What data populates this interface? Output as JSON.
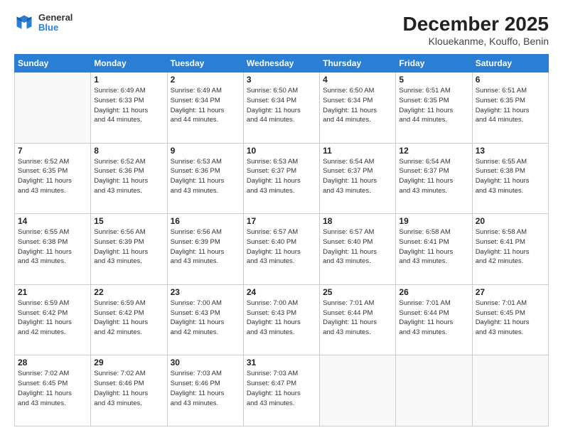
{
  "header": {
    "logo_general": "General",
    "logo_blue": "Blue",
    "month_title": "December 2025",
    "location": "Klouekanme, Kouffo, Benin"
  },
  "weekdays": [
    "Sunday",
    "Monday",
    "Tuesday",
    "Wednesday",
    "Thursday",
    "Friday",
    "Saturday"
  ],
  "weeks": [
    [
      {
        "day": "",
        "sunrise": "",
        "sunset": "",
        "daylight": ""
      },
      {
        "day": "1",
        "sunrise": "Sunrise: 6:49 AM",
        "sunset": "Sunset: 6:33 PM",
        "daylight": "Daylight: 11 hours and 44 minutes."
      },
      {
        "day": "2",
        "sunrise": "Sunrise: 6:49 AM",
        "sunset": "Sunset: 6:34 PM",
        "daylight": "Daylight: 11 hours and 44 minutes."
      },
      {
        "day": "3",
        "sunrise": "Sunrise: 6:50 AM",
        "sunset": "Sunset: 6:34 PM",
        "daylight": "Daylight: 11 hours and 44 minutes."
      },
      {
        "day": "4",
        "sunrise": "Sunrise: 6:50 AM",
        "sunset": "Sunset: 6:34 PM",
        "daylight": "Daylight: 11 hours and 44 minutes."
      },
      {
        "day": "5",
        "sunrise": "Sunrise: 6:51 AM",
        "sunset": "Sunset: 6:35 PM",
        "daylight": "Daylight: 11 hours and 44 minutes."
      },
      {
        "day": "6",
        "sunrise": "Sunrise: 6:51 AM",
        "sunset": "Sunset: 6:35 PM",
        "daylight": "Daylight: 11 hours and 44 minutes."
      }
    ],
    [
      {
        "day": "7",
        "sunrise": "Sunrise: 6:52 AM",
        "sunset": "Sunset: 6:35 PM",
        "daylight": "Daylight: 11 hours and 43 minutes."
      },
      {
        "day": "8",
        "sunrise": "Sunrise: 6:52 AM",
        "sunset": "Sunset: 6:36 PM",
        "daylight": "Daylight: 11 hours and 43 minutes."
      },
      {
        "day": "9",
        "sunrise": "Sunrise: 6:53 AM",
        "sunset": "Sunset: 6:36 PM",
        "daylight": "Daylight: 11 hours and 43 minutes."
      },
      {
        "day": "10",
        "sunrise": "Sunrise: 6:53 AM",
        "sunset": "Sunset: 6:37 PM",
        "daylight": "Daylight: 11 hours and 43 minutes."
      },
      {
        "day": "11",
        "sunrise": "Sunrise: 6:54 AM",
        "sunset": "Sunset: 6:37 PM",
        "daylight": "Daylight: 11 hours and 43 minutes."
      },
      {
        "day": "12",
        "sunrise": "Sunrise: 6:54 AM",
        "sunset": "Sunset: 6:37 PM",
        "daylight": "Daylight: 11 hours and 43 minutes."
      },
      {
        "day": "13",
        "sunrise": "Sunrise: 6:55 AM",
        "sunset": "Sunset: 6:38 PM",
        "daylight": "Daylight: 11 hours and 43 minutes."
      }
    ],
    [
      {
        "day": "14",
        "sunrise": "Sunrise: 6:55 AM",
        "sunset": "Sunset: 6:38 PM",
        "daylight": "Daylight: 11 hours and 43 minutes."
      },
      {
        "day": "15",
        "sunrise": "Sunrise: 6:56 AM",
        "sunset": "Sunset: 6:39 PM",
        "daylight": "Daylight: 11 hours and 43 minutes."
      },
      {
        "day": "16",
        "sunrise": "Sunrise: 6:56 AM",
        "sunset": "Sunset: 6:39 PM",
        "daylight": "Daylight: 11 hours and 43 minutes."
      },
      {
        "day": "17",
        "sunrise": "Sunrise: 6:57 AM",
        "sunset": "Sunset: 6:40 PM",
        "daylight": "Daylight: 11 hours and 43 minutes."
      },
      {
        "day": "18",
        "sunrise": "Sunrise: 6:57 AM",
        "sunset": "Sunset: 6:40 PM",
        "daylight": "Daylight: 11 hours and 43 minutes."
      },
      {
        "day": "19",
        "sunrise": "Sunrise: 6:58 AM",
        "sunset": "Sunset: 6:41 PM",
        "daylight": "Daylight: 11 hours and 43 minutes."
      },
      {
        "day": "20",
        "sunrise": "Sunrise: 6:58 AM",
        "sunset": "Sunset: 6:41 PM",
        "daylight": "Daylight: 11 hours and 42 minutes."
      }
    ],
    [
      {
        "day": "21",
        "sunrise": "Sunrise: 6:59 AM",
        "sunset": "Sunset: 6:42 PM",
        "daylight": "Daylight: 11 hours and 42 minutes."
      },
      {
        "day": "22",
        "sunrise": "Sunrise: 6:59 AM",
        "sunset": "Sunset: 6:42 PM",
        "daylight": "Daylight: 11 hours and 42 minutes."
      },
      {
        "day": "23",
        "sunrise": "Sunrise: 7:00 AM",
        "sunset": "Sunset: 6:43 PM",
        "daylight": "Daylight: 11 hours and 42 minutes."
      },
      {
        "day": "24",
        "sunrise": "Sunrise: 7:00 AM",
        "sunset": "Sunset: 6:43 PM",
        "daylight": "Daylight: 11 hours and 43 minutes."
      },
      {
        "day": "25",
        "sunrise": "Sunrise: 7:01 AM",
        "sunset": "Sunset: 6:44 PM",
        "daylight": "Daylight: 11 hours and 43 minutes."
      },
      {
        "day": "26",
        "sunrise": "Sunrise: 7:01 AM",
        "sunset": "Sunset: 6:44 PM",
        "daylight": "Daylight: 11 hours and 43 minutes."
      },
      {
        "day": "27",
        "sunrise": "Sunrise: 7:01 AM",
        "sunset": "Sunset: 6:45 PM",
        "daylight": "Daylight: 11 hours and 43 minutes."
      }
    ],
    [
      {
        "day": "28",
        "sunrise": "Sunrise: 7:02 AM",
        "sunset": "Sunset: 6:45 PM",
        "daylight": "Daylight: 11 hours and 43 minutes."
      },
      {
        "day": "29",
        "sunrise": "Sunrise: 7:02 AM",
        "sunset": "Sunset: 6:46 PM",
        "daylight": "Daylight: 11 hours and 43 minutes."
      },
      {
        "day": "30",
        "sunrise": "Sunrise: 7:03 AM",
        "sunset": "Sunset: 6:46 PM",
        "daylight": "Daylight: 11 hours and 43 minutes."
      },
      {
        "day": "31",
        "sunrise": "Sunrise: 7:03 AM",
        "sunset": "Sunset: 6:47 PM",
        "daylight": "Daylight: 11 hours and 43 minutes."
      },
      {
        "day": "",
        "sunrise": "",
        "sunset": "",
        "daylight": ""
      },
      {
        "day": "",
        "sunrise": "",
        "sunset": "",
        "daylight": ""
      },
      {
        "day": "",
        "sunrise": "",
        "sunset": "",
        "daylight": ""
      }
    ]
  ]
}
